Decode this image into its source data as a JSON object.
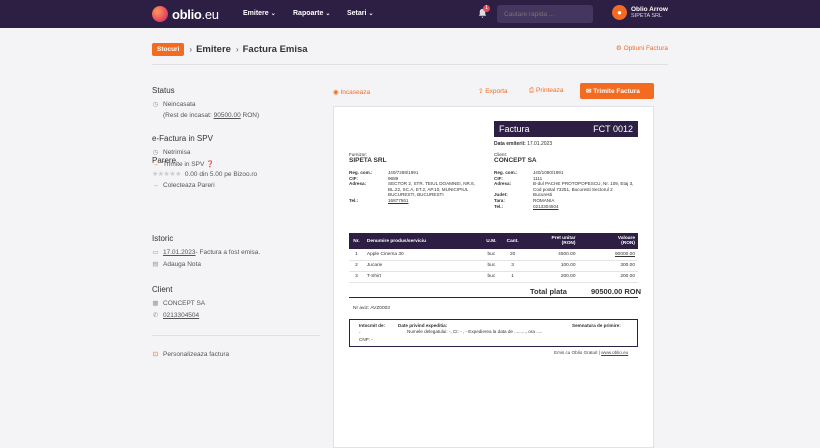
{
  "topbar": {
    "logo_brand": "oblio",
    "logo_tld": ".eu",
    "nav": [
      "Emitere",
      "Rapoarte",
      "Setari"
    ],
    "notif_count": "1",
    "search_placeholder": "Cautare rapida ...",
    "user_name": "Oblio Arrow",
    "user_company": "SIPETA SRL"
  },
  "header": {
    "stocuri": "Stocuri",
    "crumb1": "Emitere",
    "crumb2": "Factura Emisa",
    "options": "Optiuni Factura"
  },
  "sidebar": {
    "status_title": "Status",
    "status_value": "Neincasata",
    "status_rest": "(Rest de incasat:",
    "status_rest_amount": "90500.00",
    "status_rest_currency": "RON)",
    "efactura_title": "e-Factura in SPV",
    "efactura_value": "Netrimisa",
    "efactura_action": "Trimite in SPV",
    "parere_title": "Parere",
    "parere_stars": "★★★★★",
    "parere_value": "0.00 din 5.00 pe Bizoo.ro",
    "parere_action": "Colecteaza Pareri",
    "istoric_title": "Istoric",
    "istoric_date": "17.01.2023",
    "istoric_text": " - Factura a fost emisa.",
    "istoric_action": "Adauga Nota",
    "client_title": "Client",
    "client_name": "CONCEPT SA",
    "client_phone": "0213304504",
    "personalize": "Personalizeaza factura"
  },
  "actions": {
    "incaseaza": "Incaseaza",
    "exporta": "Exporta",
    "printeaza": "Printeaza",
    "trimite": "Trimite Factura"
  },
  "invoice": {
    "title": "Factura",
    "number": "FCT 0012",
    "date_label": "Data emiterii:",
    "date": "17.01.2023",
    "supplier": {
      "label": "Furnizor:",
      "name": "SIPETA SRL",
      "reg_k": "Reg. com.:",
      "reg": "J40/7268/1991",
      "cif_k": "CIF:",
      "cif": "9689",
      "addr_k": "Adresa:",
      "addr": "SECTOR 2, STR. TEIUL DOAMNEI, NR.6, BL.22, SC.A, ET.2, AP.10, MUNICIPIUL BUCURESTI, BUCURESTI",
      "tel_k": "Tel.:",
      "tel": "16877561"
    },
    "client": {
      "label": "Client:",
      "name": "CONCEPT SA",
      "reg_k": "Reg. com.:",
      "reg": "J40/1090/1991",
      "cif_k": "CIF:",
      "cif": "1111",
      "addr_k": "Adresa:",
      "addr": "B-dul PACHE PROTOPOPESCU, Nr. 109, Etaj 3, Cod postal 73251, Bucuresti Sectorul 2",
      "judet_k": "Judet:",
      "judet": "Bucuresti",
      "tara_k": "Tara:",
      "tara": "ROMANIA",
      "tel_k": "Tel.:",
      "tel": "0213304504"
    },
    "columns": [
      "Nr.",
      "Denumire produs/serviciu",
      "U.M.",
      "Cant.",
      "Pret unitar",
      "(RON)",
      "Valoare",
      "(RON)"
    ],
    "rows": [
      {
        "nr": "1",
        "name": "Apple Cinema 30",
        "um": "buc",
        "qty": "20",
        "price": "4500.00",
        "value": "90000.00"
      },
      {
        "nr": "2",
        "name": "Jucarie",
        "um": "buc",
        "qty": "3",
        "price": "100.00",
        "value": "300.00"
      },
      {
        "nr": "3",
        "name": "T-Shirt",
        "um": "buc",
        "qty": "1",
        "price": "200.00",
        "value": "200.00"
      }
    ],
    "total_label": "Total plata",
    "total_value": "90500.00 RON",
    "nr_aviz": "Nr aviz: AVZ0003",
    "exp_intocmit": "Intocmit de:",
    "exp_dash": "-",
    "exp_cnp": "CNP: -",
    "exp_title": "Date privind expeditia:",
    "exp_text": "Numele delegatului: -, CI: - , - Expedierea la data de ........., ora .....",
    "exp_sign": "Semnatura de primire:",
    "credit_prefix": "Emis cu Oblio Gratuit | ",
    "credit_link": "www.oblio.eu"
  }
}
